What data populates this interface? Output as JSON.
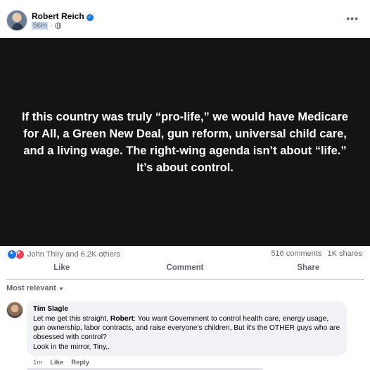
{
  "post": {
    "author": "Robert Reich",
    "time": "56m",
    "more_label": "•••",
    "quote": "If this country was truly “pro-life,” we would have Medicare for All, a Green New Deal, gun reform, universal child care, and a living wage. The right-wing agenda isn’t about “life.” It’s about control."
  },
  "stats": {
    "reactors": "John Thiry and 6.2K others",
    "comments": "516 comments",
    "shares": "1K shares"
  },
  "actions": {
    "like": "Like",
    "comment": "Comment",
    "share": "Share"
  },
  "sort": {
    "label": "Most relevant"
  },
  "comment": {
    "author": "Tim Slagle",
    "text_before": "Let me get this straight, ",
    "text_bold": "Robert",
    "text_after": ": You want Government to control health care, energy usage, gun ownership, labor contracts, and raise everyone's children, But it's the OTHER guys who are obsessed with control?\nLook in the mirror, Tiny,.",
    "time": "1m",
    "like": "Like",
    "reply": "Reply"
  },
  "colors": {
    "accent": "#1877f2",
    "love": "#f33e58",
    "image_bg": "#141414",
    "bubble": "#f0f2f5"
  }
}
